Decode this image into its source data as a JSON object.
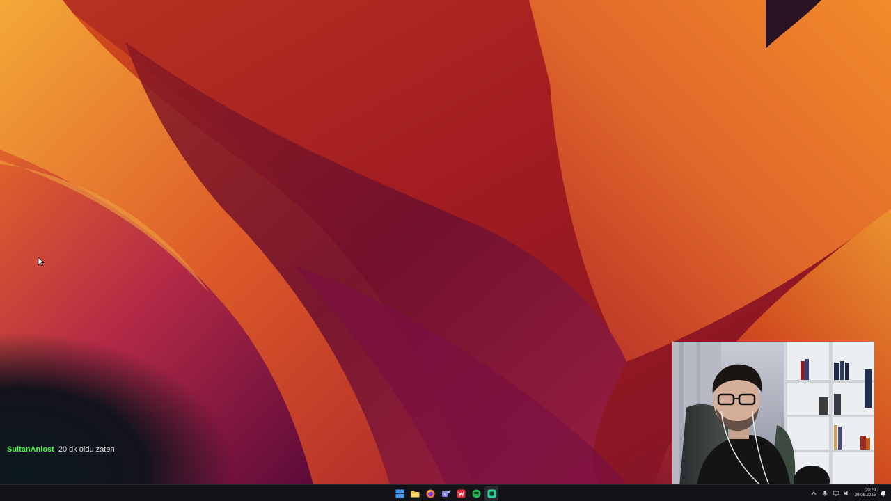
{
  "chat": {
    "username": "SultanAnlost",
    "message": "20 dk oldu zaten",
    "username_color": "#44ff44"
  },
  "taskbar": {
    "pinned": [
      {
        "name": "start-button",
        "icon": "windows-icon",
        "color": "#3aa0ff"
      },
      {
        "name": "file-explorer-button",
        "icon": "folder-icon",
        "color": "#f5c542"
      },
      {
        "name": "firefox-button",
        "icon": "firefox-icon",
        "color": "#ff7139"
      },
      {
        "name": "teams-button",
        "icon": "teams-icon",
        "color": "#7b83eb"
      },
      {
        "name": "app-red-button",
        "icon": "w-app-icon",
        "color": "#e8283a"
      },
      {
        "name": "spotify-button",
        "icon": "spotify-icon",
        "color": "#1db954"
      },
      {
        "name": "app-green-button",
        "icon": "app-green-icon",
        "color": "#2fd39a"
      }
    ],
    "clock": {
      "time": "20:29",
      "date": "29.08.2025"
    }
  },
  "colors": {
    "taskbar_bg": "#141418",
    "wallpaper_orange": "#f08a24",
    "wallpaper_red": "#c0271e",
    "wallpaper_magenta": "#7a1040",
    "wallpaper_dark": "#12161c"
  }
}
